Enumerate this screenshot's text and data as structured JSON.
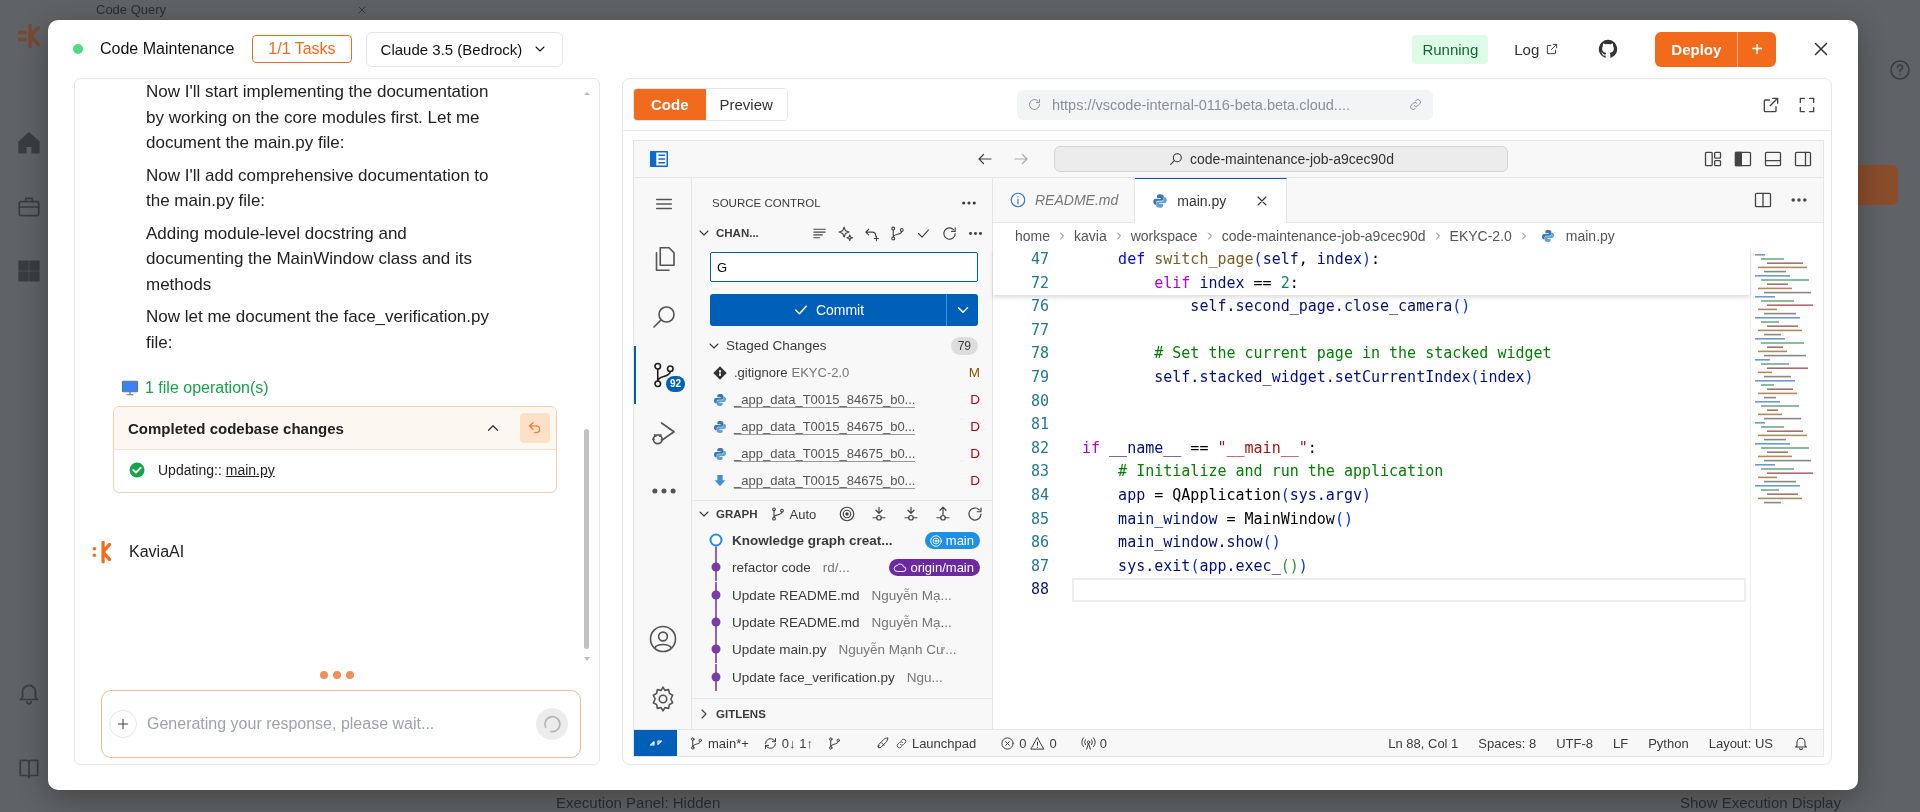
{
  "backdrop": {
    "tab_title": "Code Query",
    "footer_left": "Execution Panel: Hidden",
    "footer_right": "Show Execution Display"
  },
  "header": {
    "active": true,
    "title": "Code Maintenance",
    "tasks": "1/1 Tasks",
    "model": "Claude 3.5 (Bedrock)",
    "status": "Running",
    "log_link": "Log",
    "deploy_button": "Deploy",
    "deploy_add": "+"
  },
  "chat": {
    "messages": [
      "Now I'll start implementing the documentation by working on the core modules first. Let me document the main.py file:",
      "Now I'll add comprehensive documentation to the main.py file:",
      "Adding module-level docstring and documenting the MainWindow class and its methods",
      "Now let me document the face_verification.py file:"
    ],
    "file_operations": "1 file operation(s)",
    "changes_card": {
      "title": "Completed codebase changes",
      "expanded": true,
      "items": [
        {
          "action": "Updating::",
          "file": "main.py",
          "done": true
        }
      ]
    },
    "agent_name": "KaviaAI",
    "typing": true,
    "input": {
      "placeholder": "Generating your response, please wait..."
    }
  },
  "preview_tabs": [
    {
      "label": "Code",
      "selected": true
    },
    {
      "label": "Preview",
      "selected": false
    }
  ],
  "url": "https://vscode-internal-0116-beta.beta.cloud....",
  "vscode": {
    "command_center": "code-maintenance-job-a9cec90d",
    "activity_bar": [
      {
        "kind": "explorer",
        "selected": false
      },
      {
        "kind": "search",
        "selected": false
      },
      {
        "kind": "source-control",
        "selected": true,
        "badge": "92"
      },
      {
        "kind": "run",
        "selected": false
      },
      {
        "kind": "more",
        "selected": false
      }
    ],
    "sidebar": {
      "title": "SOURCE CONTROL",
      "changes_section": "CHAN...",
      "commit_message": "G",
      "commit_button": "Commit",
      "staged": {
        "label": "Staged Changes",
        "count": "79",
        "expanded": true
      },
      "files": [
        {
          "kind": "git",
          "name": ".gitignore",
          "folder": "EKYC-2.0",
          "status": "M",
          "deleted": false
        },
        {
          "kind": "python",
          "name": "_app_data_T0015_84675_b0...",
          "status": "D",
          "deleted": true
        },
        {
          "kind": "python",
          "name": "_app_data_T0015_84675_b0...",
          "status": "D",
          "deleted": true
        },
        {
          "kind": "python",
          "name": "_app_data_T0015_84675_b0...",
          "status": "D",
          "deleted": true
        },
        {
          "kind": "download",
          "name": "_app_data_T0015_84675_b0...",
          "status": "D",
          "deleted": true
        }
      ],
      "graph": {
        "title": "GRAPH",
        "mode": "Auto",
        "expanded": true,
        "commits": [
          {
            "message": "Knowledge graph creat...",
            "current": true,
            "ref": {
              "label": "main",
              "kind": "local"
            }
          },
          {
            "message": "refactor code",
            "author": "rd/...",
            "current": false,
            "ref": {
              "label": "origin/main",
              "kind": "remote"
            }
          },
          {
            "message": "Update README.md",
            "author": "Nguyễn Mạ...",
            "current": false
          },
          {
            "message": "Update README.md",
            "author": "Nguyễn Mạ...",
            "current": false
          },
          {
            "message": "Update main.py",
            "author": "Nguyễn Mạnh Cư...",
            "current": false
          },
          {
            "message": "Update face_verification.py",
            "author": "Ngu...",
            "current": false
          }
        ]
      },
      "gitlens": {
        "title": "GITLENS",
        "expanded": false
      }
    },
    "editor": {
      "tabs": [
        {
          "label": "README.md",
          "kind": "info",
          "preview": true,
          "selected": false
        },
        {
          "label": "main.py",
          "kind": "python",
          "preview": false,
          "selected": true
        }
      ],
      "breadcrumbs": [
        {
          "label": "home",
          "kind": "folder"
        },
        {
          "label": "kavia",
          "kind": "folder"
        },
        {
          "label": "workspace",
          "kind": "folder"
        },
        {
          "label": "code-maintenance-job-a9cec90d",
          "kind": "folder"
        },
        {
          "label": "EKYC-2.0",
          "kind": "folder"
        },
        {
          "label": "main.py",
          "kind": "python"
        }
      ],
      "sticky_lines": [
        {
          "number": "47",
          "tokens": [
            {
              "text": "    def",
              "kind": "keyword"
            },
            {
              "text": " switch_page",
              "kind": "function"
            },
            {
              "text": "(",
              "kind": "bracket"
            },
            {
              "text": "self",
              "kind": "variable"
            },
            {
              "text": ", ",
              "kind": "plain"
            },
            {
              "text": "index",
              "kind": "variable"
            },
            {
              "text": ")",
              "kind": "bracket"
            },
            {
              "text": ":",
              "kind": "plain"
            }
          ]
        },
        {
          "number": "72",
          "tokens": [
            {
              "text": "        elif",
              "kind": "control"
            },
            {
              "text": " index",
              "kind": "variable"
            },
            {
              "text": " == ",
              "kind": "plain"
            },
            {
              "text": "2",
              "kind": "number"
            },
            {
              "text": ":",
              "kind": "plain"
            }
          ]
        }
      ],
      "lines": [
        {
          "number": "76",
          "current": false,
          "tokens": [
            {
              "text": "            self.second_page.close_camera",
              "kind": "variable"
            },
            {
              "text": "()",
              "kind": "bracket"
            }
          ]
        },
        {
          "number": "77",
          "current": false
        },
        {
          "number": "78",
          "current": false,
          "tokens": [
            {
              "text": "        # Set the current page in the stacked widget",
              "kind": "comment"
            }
          ]
        },
        {
          "number": "79",
          "current": false,
          "tokens": [
            {
              "text": "        self.stacked_widget.setCurrentIndex",
              "kind": "variable"
            },
            {
              "text": "(",
              "kind": "bracket"
            },
            {
              "text": "index",
              "kind": "variable"
            },
            {
              "text": ")",
              "kind": "bracket"
            }
          ]
        },
        {
          "number": "80",
          "current": false
        },
        {
          "number": "81",
          "current": false
        },
        {
          "number": "82",
          "current": false,
          "tokens": [
            {
              "text": "if",
              "kind": "control"
            },
            {
              "text": " __name__",
              "kind": "variable"
            },
            {
              "text": " == ",
              "kind": "plain"
            },
            {
              "text": "\"__main__\"",
              "kind": "string"
            },
            {
              "text": ":",
              "kind": "plain"
            }
          ]
        },
        {
          "number": "83",
          "current": false,
          "tokens": [
            {
              "text": "    # Initialize and run the application",
              "kind": "comment"
            }
          ]
        },
        {
          "number": "84",
          "current": false,
          "tokens": [
            {
              "text": "    app",
              "kind": "variable"
            },
            {
              "text": " = QApplication",
              "kind": "plain"
            },
            {
              "text": "(",
              "kind": "bracket"
            },
            {
              "text": "sys.argv",
              "kind": "variable"
            },
            {
              "text": ")",
              "kind": "bracket"
            }
          ]
        },
        {
          "number": "85",
          "current": false,
          "tokens": [
            {
              "text": "    main_window",
              "kind": "variable"
            },
            {
              "text": " = MainWindow",
              "kind": "plain"
            },
            {
              "text": "()",
              "kind": "bracket"
            }
          ]
        },
        {
          "number": "86",
          "current": false,
          "tokens": [
            {
              "text": "    main_window.show",
              "kind": "variable"
            },
            {
              "text": "()",
              "kind": "bracket"
            }
          ]
        },
        {
          "number": "87",
          "current": false,
          "tokens": [
            {
              "text": "    sys.exit",
              "kind": "variable"
            },
            {
              "text": "(",
              "kind": "bracket"
            },
            {
              "text": "app.exec_",
              "kind": "variable"
            },
            {
              "text": "()",
              "kind": "bracket2"
            },
            {
              "text": ")",
              "kind": "bracket"
            }
          ]
        },
        {
          "number": "88",
          "current": true
        }
      ]
    },
    "status_bar": {
      "branch": "main*+",
      "sync": "0↓ 1↑",
      "launchpad": "Launchpad",
      "errors": "0",
      "warnings": "0",
      "ports": "0",
      "right": [
        "Ln 88, Col 1",
        "Spaces: 8",
        "UTF-8",
        "LF",
        "Python",
        "Layout: US"
      ]
    }
  }
}
